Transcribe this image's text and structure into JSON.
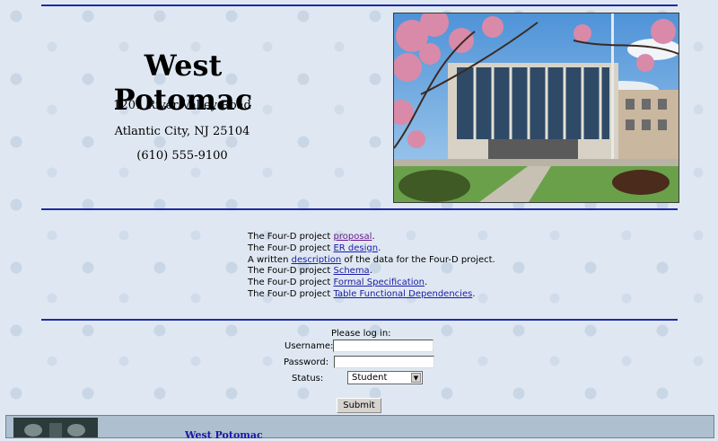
{
  "header": {
    "school_name": "West Potomac",
    "address_line1": "1201 River Valley Road",
    "address_line2": "Atlantic City, NJ 25104",
    "phone": "(610) 555-9100"
  },
  "links": [
    {
      "prefix": "The Four-D project ",
      "link": "proposal",
      "suffix": ".",
      "visited": true
    },
    {
      "prefix": "The Four-D project ",
      "link": "ER design",
      "suffix": ".",
      "visited": false
    },
    {
      "prefix": "A written ",
      "link": "description",
      "suffix": " of the data for the Four-D project.",
      "visited": false
    },
    {
      "prefix": "The Four-D project ",
      "link": "Schema",
      "suffix": ".",
      "visited": false
    },
    {
      "prefix": "The Four-D project ",
      "link": "Formal Specification",
      "suffix": ".",
      "visited": false
    },
    {
      "prefix": "The Four-D project ",
      "link": "Table Functional Dependencies",
      "suffix": ".",
      "visited": false
    }
  ],
  "login": {
    "title": "Please log in:",
    "username_label": "Username:",
    "password_label": "Password:",
    "status_label": "Status:",
    "username_value": "",
    "password_value": "",
    "status_selected": "Student",
    "submit_label": "Submit"
  },
  "footer": {
    "text": "West Potomac"
  },
  "colors": {
    "rule": "#1e2aa8",
    "link": "#1a1aa6",
    "visited_link": "#6a1a8a",
    "background": "#dfe8f2"
  }
}
